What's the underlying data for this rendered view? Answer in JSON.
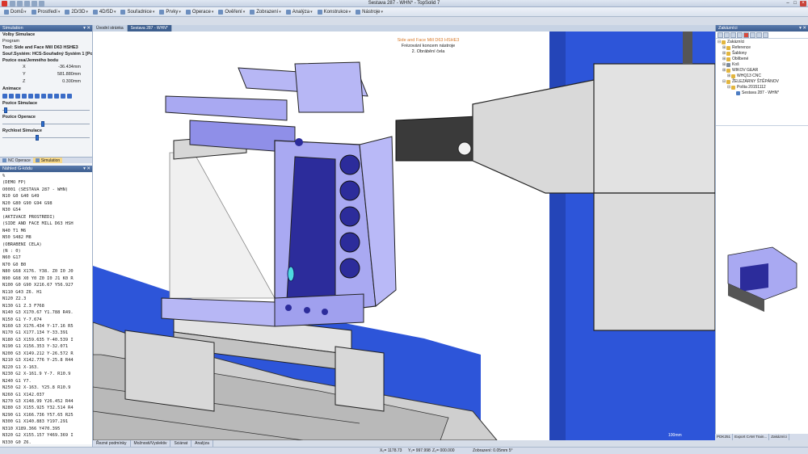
{
  "window": {
    "title": "Sestava 287 - WHN* - TopSolid 7"
  },
  "menu": [
    {
      "label": "Domů",
      "dropdown": true
    },
    {
      "label": "Prostředí",
      "dropdown": true
    },
    {
      "label": "2D/3D",
      "dropdown": true
    },
    {
      "label": "4D/5D",
      "dropdown": true
    },
    {
      "label": "Souřadnice",
      "dropdown": true
    },
    {
      "label": "Prvky",
      "dropdown": true
    },
    {
      "label": "Opera­ce",
      "dropdown": true
    },
    {
      "label": "Ověření",
      "dropdown": true
    },
    {
      "label": "Zobrazení",
      "dropdown": true
    },
    {
      "label": "Analýza",
      "dropdown": true
    },
    {
      "label": "Konstrukce",
      "dropdown": true
    },
    {
      "label": "Nástroje",
      "dropdown": true
    }
  ],
  "doc_tabs": [
    {
      "label": "Úvodní stránka",
      "active": false
    },
    {
      "label": "Sestava 287 - WHN*",
      "active": true
    }
  ],
  "simulation_panel": {
    "header": "Simulation",
    "header_buttons": "▾ ✕",
    "speed_section": "Volby Simulace",
    "program_label": "Program",
    "tool": "Tool: Side and Face Mill D63 HSHE3",
    "system": "Souř.Systém: HCS-Souřadný Systém 1 [Počá...",
    "position_section": "Pozice osa/Jemného bodu",
    "coords": [
      {
        "axis": "X",
        "value": "-36.434mm"
      },
      {
        "axis": "Y",
        "value": "581.880mm"
      },
      {
        "axis": "Z",
        "value": "0.300mm"
      }
    ],
    "animace_label": "Animace",
    "animace_buttons": 11,
    "sliders": [
      {
        "label": "Pozice Simulace",
        "value": 0.02
      },
      {
        "label": "Pozice Operace",
        "value": 0.44
      },
      {
        "label": "Rychlost Simulace",
        "value": 0.38
      }
    ],
    "tabs": [
      {
        "label": "NC Operace",
        "active": false
      },
      {
        "label": "Simulation",
        "active": true
      }
    ]
  },
  "gcode_panel": {
    "header": "Náhled G-kódu",
    "header_buttons": "▾ ✕",
    "lines": [
      "%",
      "(DEMO FP)",
      "O0001 (SESTAVA 287 - WHN)",
      "N10 G0 G40 G49",
      "N20 G80 G90 G94 G98",
      "N30 G54",
      "(AKTIVACE PROSTREDI)",
      "",
      "(SIDE AND FACE MILL D63 HSH",
      "N40 T1 M6",
      "N50 S482 M8",
      "(OBRABENI CELA)",
      "(N : 0)",
      "N60 G17",
      "N70 G0 B0",
      "N80 G68 X176. Y38. Z0 I0 J0",
      "N90 G68 X0 Y0 Z0 I0 J1 K0 R",
      "N100 G0 G90 X216.67 Y56.927",
      "N110 G43 Z6. H1",
      "N120 Z2.3",
      "N130 G1 Z.3 F768",
      "N140 G3 X170.67 Y1.788 R49.",
      "N150 G1 Y-7.674",
      "N160 G3 X176.434 Y-17.16 R5",
      "N170 G1 X177.134 Y-33.391",
      "N180 G3 X159.635 Y-40.539 I",
      "N190 G1 X156.353 Y-32.071",
      "N200 G3 X149.212 Y-26.572 R",
      "N210 G3 X142.776 Y-25.8 R44",
      "N220 G1 X-163.",
      "N230 G2 X-161.9 Y-7. R10.9",
      "N240 G1 Y7.",
      "N250 G2 X-163. Y25.8 R10.9",
      "N260 G1 X142.037",
      "N270 G3 X148.99 Y26.452 R44",
      "N280 G3 X155.925 Y32.514 R4",
      "N290 G1 X166.736 Y57.65 R25",
      "N300 G1 X140.883 Y197.291",
      "N310 X189.366 Y470.395",
      "N320 G2 X155.157 Y469.369 I",
      "N330 G0 Z6.",
      "N340 X216.67 Y518.838",
      "N350 Z2.3",
      "N360 G1 Z.3"
    ]
  },
  "viewport": {
    "caption_line1": "Side and Face Mill D63 HSHE3",
    "caption_line2": "Frézování koncem nástroje",
    "caption_line3": "2. Obrábění čela",
    "scale_label": "100mm",
    "bottom_tabs": [
      "Řezné podmínky",
      "Možnosti/Vyslektiv",
      "Sciánat",
      "Analýza"
    ]
  },
  "right_panel": {
    "header": "Zakázníci",
    "header_buttons": "▾ ✕",
    "tree": [
      {
        "label": "Zakázníci",
        "level": 0,
        "expander": "⊟",
        "color": "#e2b53d"
      },
      {
        "label": "Reference",
        "level": 1,
        "expander": "⊞",
        "color": "#e2b53d"
      },
      {
        "label": "Šablony",
        "level": 1,
        "expander": "⊞",
        "color": "#e2b53d"
      },
      {
        "label": "Oblíbené",
        "level": 1,
        "expander": "⊞",
        "color": "#e2b53d"
      },
      {
        "label": "Koš",
        "level": 1,
        "expander": "⊞",
        "color": "#7d8b9c"
      },
      {
        "label": "WIKOV GEAR",
        "level": 1,
        "expander": "⊞",
        "color": "#e2b53d"
      },
      {
        "label": "WHQ13 CNC",
        "level": 2,
        "expander": "⊞",
        "color": "#e2b53d"
      },
      {
        "label": "ŽELEZÁRNY ŠTĚPÁNOV",
        "level": 1,
        "expander": "⊟",
        "color": "#e2b53d"
      },
      {
        "label": "Pošta 20151112",
        "level": 2,
        "expander": "⊟",
        "color": "#e2b53d"
      },
      {
        "label": "Sestava 287 - WHN*",
        "level": 3,
        "expander": "",
        "color": "#4c7cc2"
      }
    ],
    "bottom_tabs": [
      "PDK251",
      "Export CAM Train...",
      "Zakázníci"
    ]
  },
  "status": {
    "x": "X₀= 1178.73",
    "y": "Y₀= 997.998",
    "z": "Z₀= 000.000",
    "zoom": "Zobrazení: 0.05mm 5°"
  },
  "colors": {
    "part_lavender": "#a9a9f2",
    "part_dark": "#2c2c9b",
    "machine_blue": "#2d55d9",
    "tool_gray": "#d9d9d9",
    "header_blue": "#3c5d8f"
  }
}
